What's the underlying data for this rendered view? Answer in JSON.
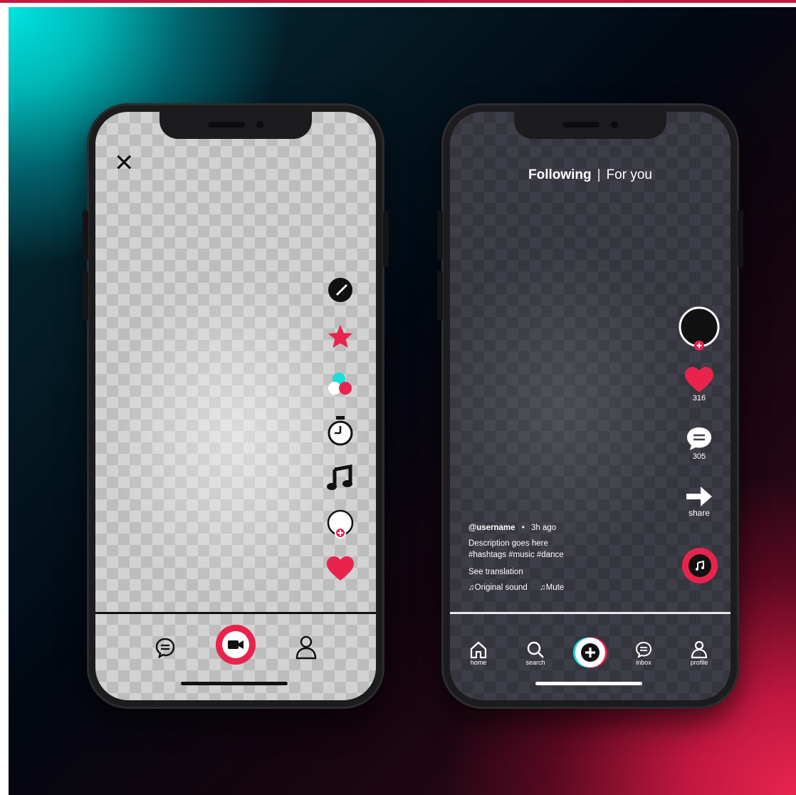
{
  "colors": {
    "accent_pink": "#e8244d",
    "accent_cyan": "#19e0da",
    "phone_body": "#1c1c1e"
  },
  "left_phone": {
    "close_icon": "close-icon",
    "close_glyph": "✕",
    "tools": [
      "flip-camera-icon",
      "star-effects-icon",
      "filters-icon",
      "timer-icon",
      "music-note-icon",
      "beauty-icon",
      "heart-icon"
    ],
    "bottom_nav": [
      "chat-icon",
      "record-video-button",
      "profile-icon"
    ]
  },
  "right_phone": {
    "top_tabs": {
      "following": "Following",
      "separator": "|",
      "for_you": "For you"
    },
    "actions": {
      "likes_count": "316",
      "comments_count": "305",
      "share_label": "share"
    },
    "caption": {
      "username": "@username",
      "dot": "•",
      "time_ago": "3h ago",
      "description": "Description goes here",
      "hashtags": "#hashtags #music #dance",
      "see_translation": "See translation",
      "original_sound": "♫Original sound",
      "mute": "♫Mute"
    },
    "bottom_nav": {
      "home": "home",
      "search": "search",
      "inbox": "inbox",
      "profile": "profile"
    }
  }
}
